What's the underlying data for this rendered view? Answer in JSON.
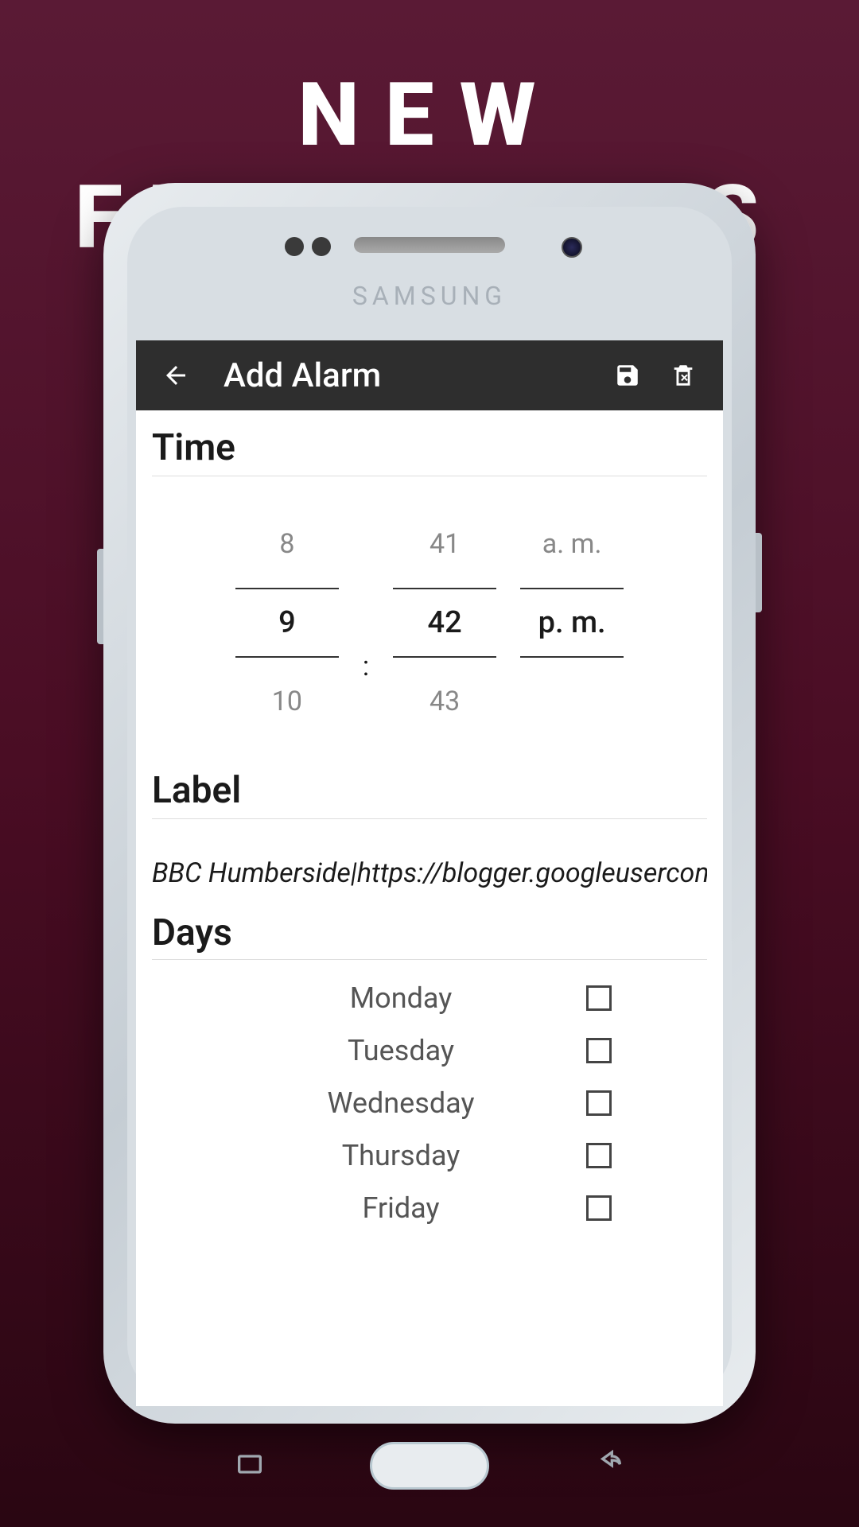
{
  "headline": "NEW FUNCTIONS",
  "phone_brand": "SAMSUNG",
  "app_bar": {
    "title": "Add Alarm"
  },
  "time_section": {
    "title": "Time",
    "hour_prev": "8",
    "hour_sel": "9",
    "hour_next": "10",
    "min_prev": "41",
    "min_sel": "42",
    "min_next": "43",
    "ampm_prev": "a. m.",
    "ampm_sel": "p. m.",
    "separator": ":"
  },
  "label_section": {
    "title": "Label",
    "value": "BBC Humberside|https://blogger.googleusercontent"
  },
  "days_section": {
    "title": "Days",
    "days": [
      {
        "name": "Monday",
        "checked": false
      },
      {
        "name": "Tuesday",
        "checked": false
      },
      {
        "name": "Wednesday",
        "checked": false
      },
      {
        "name": "Thursday",
        "checked": false
      },
      {
        "name": "Friday",
        "checked": false
      }
    ]
  }
}
